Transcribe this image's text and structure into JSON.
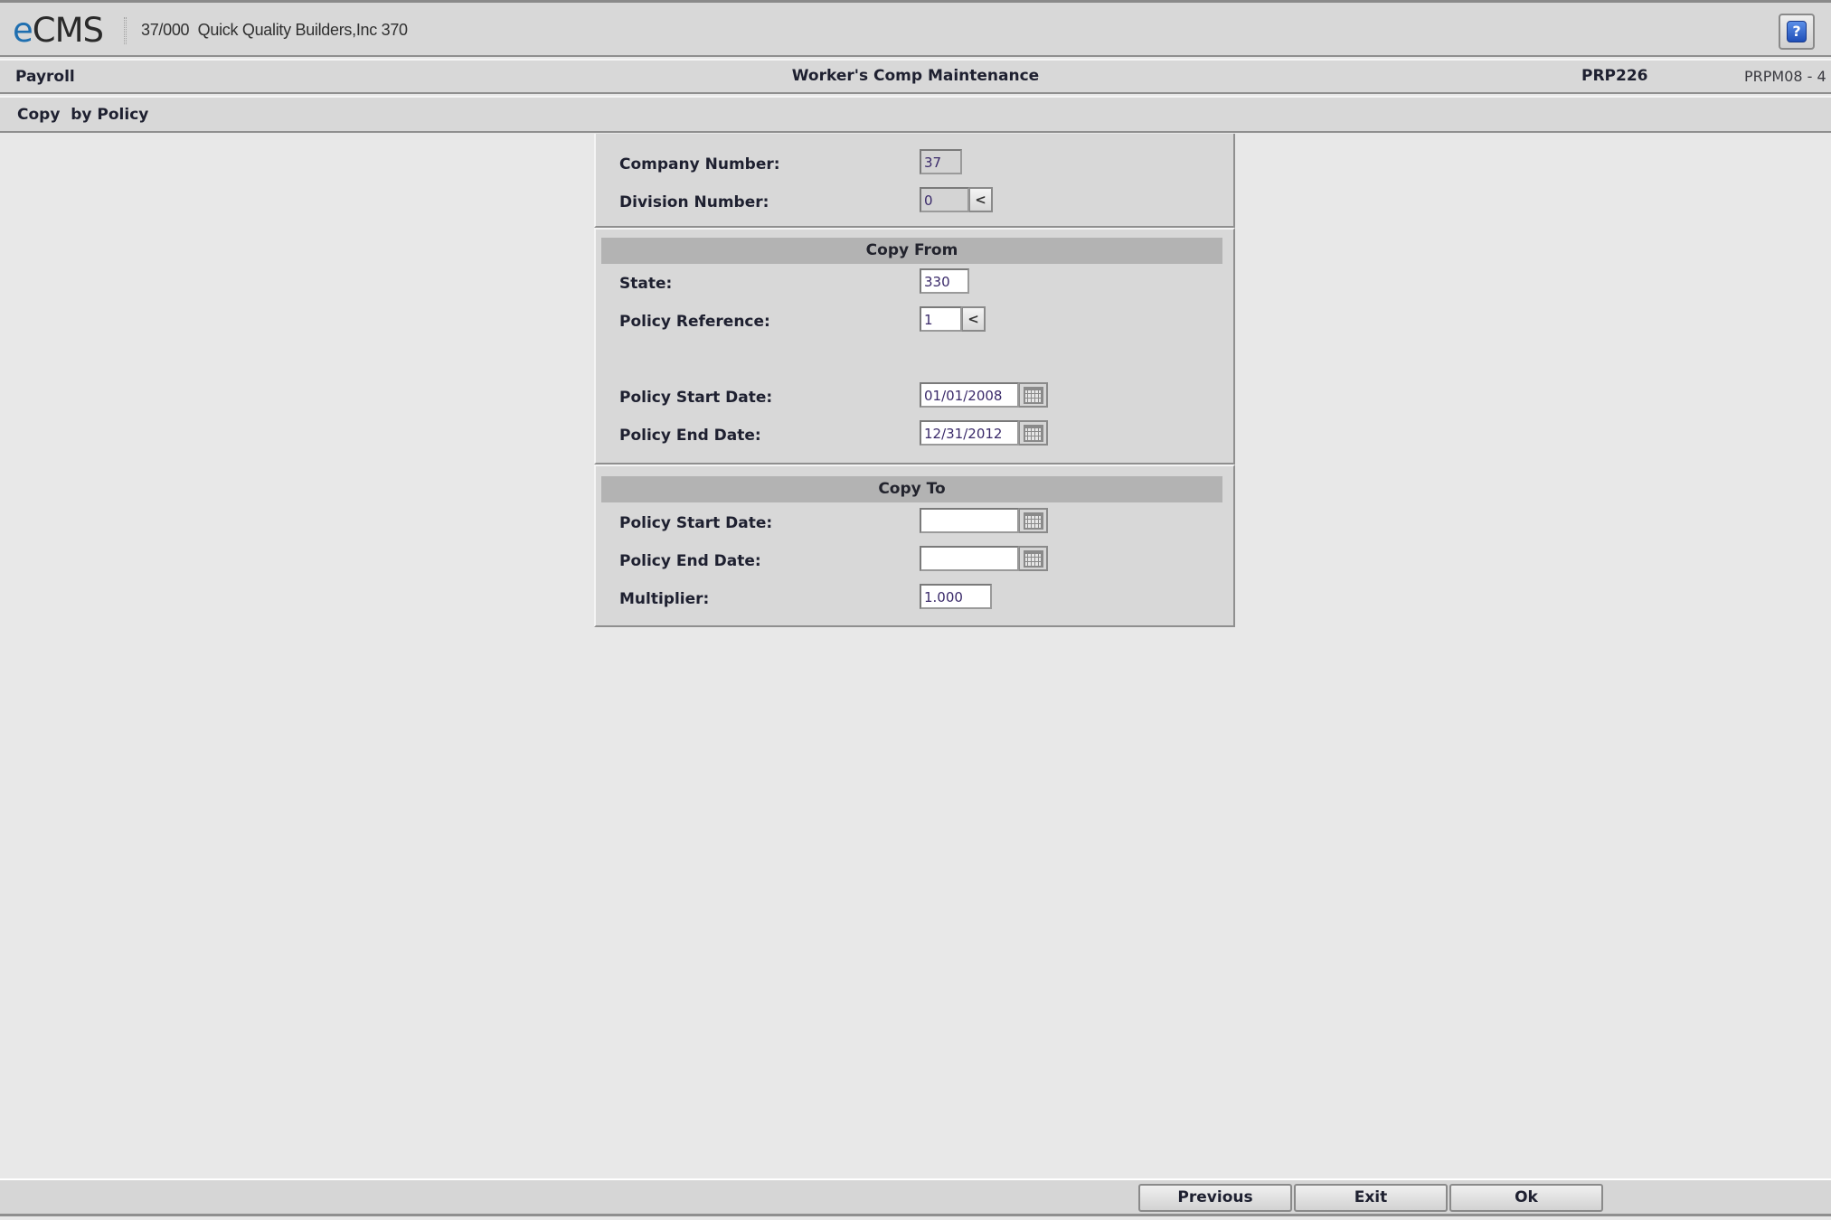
{
  "app": {
    "logo_prefix": "e",
    "logo_suffix": "CMS",
    "company_info": "37/000  Quick Quality Builders,Inc 370",
    "help_label": "?"
  },
  "header": {
    "module": "Payroll",
    "title": "Worker's Comp Maintenance",
    "program": "PRP226",
    "screen_id": "PRPM08 - 4",
    "subtitle": "Copy  by Policy"
  },
  "form": {
    "company": {
      "label": "Company Number:",
      "value": "37"
    },
    "division": {
      "label": "Division Number:",
      "value": "0",
      "lookup_icon": "<"
    },
    "copy_from": {
      "heading": "Copy From",
      "state": {
        "label": "State:",
        "value": "330"
      },
      "policy_reference": {
        "label": "Policy Reference:",
        "value": "1",
        "lookup_icon": "<"
      },
      "policy_start_date": {
        "label": "Policy Start Date:",
        "value": "01/01/2008"
      },
      "policy_end_date": {
        "label": "Policy End Date:",
        "value": "12/31/2012"
      }
    },
    "copy_to": {
      "heading": "Copy To",
      "policy_start_date": {
        "label": "Policy Start Date:",
        "value": ""
      },
      "policy_end_date": {
        "label": "Policy End Date:",
        "value": ""
      },
      "multiplier": {
        "label": "Multiplier:",
        "value": "1.000"
      }
    }
  },
  "footer": {
    "previous_label": "Previous",
    "exit_label": "Exit",
    "ok_label": "Ok"
  },
  "colors": {
    "logo_accent": "#1f6fb0",
    "bar_bg": "#d8d8d8",
    "page_bg": "#e8e8e8",
    "section_head_bg": "#b3b3b3",
    "help_blue": "#2f5fc8"
  }
}
